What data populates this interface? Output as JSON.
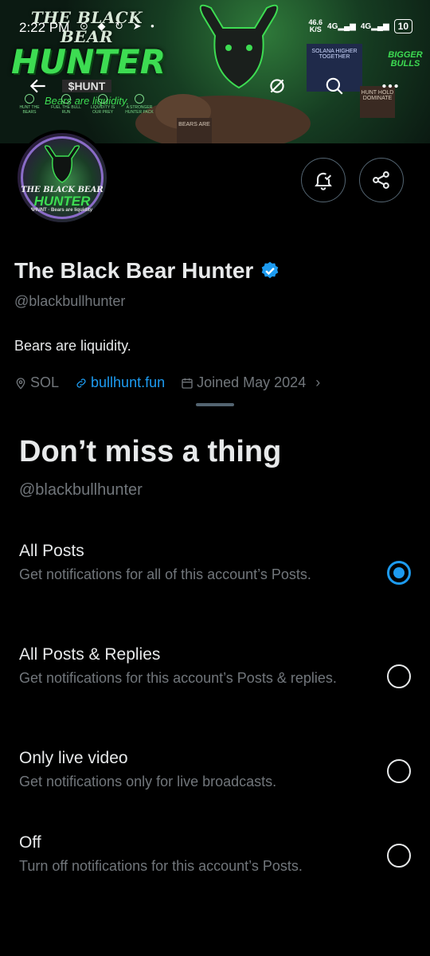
{
  "status_bar": {
    "time": "2:22 PM",
    "notif_icons": "⊙ ◆ ↻ ➤ •",
    "net_speed_value": "46.6",
    "net_speed_unit": "K/S",
    "net1": "4G",
    "net2": "4G",
    "battery": "10"
  },
  "banner": {
    "title_line1": "THE BLACK BEAR",
    "title_line2": "HUNTER",
    "ticker": "$HUNT",
    "tagline": "Bears are liquidity.",
    "features": [
      "HUNT THE BEARS",
      "FUEL THE BULL RUN",
      "LIQUIDITY IS OUR PREY",
      "A STRONGER HUNTER PACK"
    ],
    "flag_text": "SOLANA HIGHER TOGETHER",
    "sign_text": "HUNT HOLD DOMINATE",
    "sign2_text": "BEARS ARE",
    "side_text": "BIGGER BULLS"
  },
  "avatar": {
    "line1": "THE BLACK BEAR",
    "line2": "HUNTER",
    "line3": "$HUNT",
    "line4": "Bears are liquidity."
  },
  "profile": {
    "name": "The Black Bear Hunter",
    "handle": "@blackbullhunter",
    "bio": "Bears are liquidity.",
    "location": "SOL",
    "website": "bullhunt.fun",
    "joined": "Joined May 2024"
  },
  "sheet": {
    "title": "Don’t miss a thing",
    "handle": "@blackbullhunter",
    "options": [
      {
        "label": "All Posts",
        "desc": "Get notifications for all of this account’s Posts.",
        "selected": true
      },
      {
        "label": "All Posts & Replies",
        "desc": "Get notifications for this account’s Posts & replies.",
        "selected": false
      },
      {
        "label": "Only live video",
        "desc": "Get notifications only for live broadcasts.",
        "selected": false
      },
      {
        "label": "Off",
        "desc": "Turn off notifications for this account’s Posts.",
        "selected": false
      }
    ]
  },
  "colors": {
    "accent": "#1d9bf0",
    "muted": "#71767b",
    "text": "#e7e9ea",
    "background": "#000000",
    "banner_green": "#3ddc52"
  }
}
